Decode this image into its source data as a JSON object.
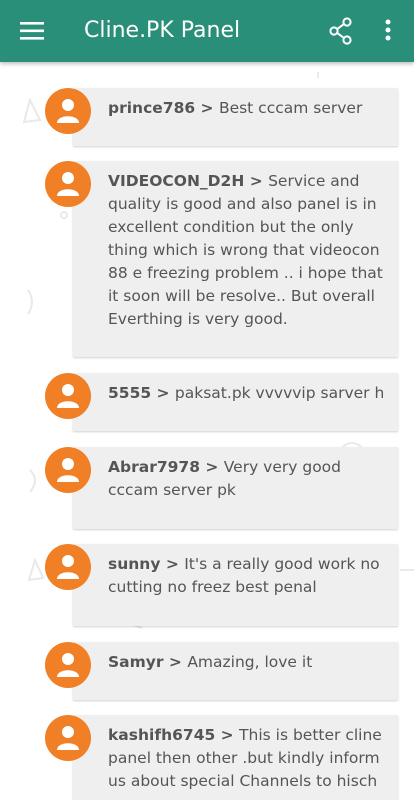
{
  "app": {
    "title": "Cline.PK Panel",
    "colors": {
      "appbar": "#2a8f79",
      "avatar": "#f07f25",
      "card": "#efefef",
      "text": "#555555"
    },
    "icons": {
      "menu": "menu-icon",
      "share": "share-icon",
      "more": "more-vert-icon",
      "avatar": "user-icon"
    }
  },
  "reviews": [
    {
      "author": "prince786",
      "separator": " > ",
      "text": "Best cccam server"
    },
    {
      "author": "VIDEOCON_D2H",
      "separator": " > ",
      "text": "Service and quality is good and also panel is in excellent condition but the only thing which is wrong that videocon 88 e freezing problem .. i hope that it soon will be resolve.. But overall Everthing is very good."
    },
    {
      "author": "5555",
      "separator": " > ",
      "text": "paksat.pk vvvvvip sarver h"
    },
    {
      "author": "Abrar7978",
      "separator": " > ",
      "text": "Very very good cccam server pk"
    },
    {
      "author": "sunny",
      "separator": " > ",
      "text": "It's a really good work no cutting no freez best penal"
    },
    {
      "author": "Samyr",
      "separator": " > ",
      "text": "Amazing, love it"
    },
    {
      "author": "kashifh6745",
      "separator": " > ",
      "text": "This is better cline panel then other .but kindly inform us about special Channels to hisch"
    }
  ]
}
